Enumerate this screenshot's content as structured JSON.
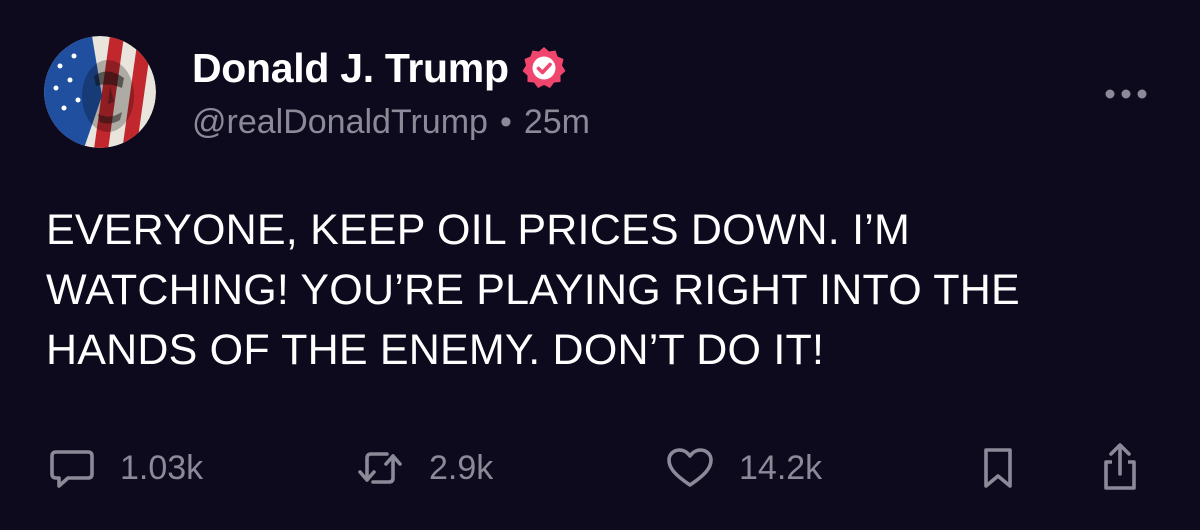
{
  "post": {
    "author": {
      "display_name": "Donald J. Trump",
      "handle": "@realDonaldTrump",
      "verified": true,
      "avatar_icon": "avatar-flag-portrait"
    },
    "separator": "•",
    "timestamp": "25m",
    "text": "EVERYONE, KEEP OIL PRICES DOWN. I’M WATCHING! YOU’RE PLAYING RIGHT INTO THE HANDS OF THE ENEMY. DON’T DO IT!",
    "actions": {
      "reply": {
        "icon": "comment-icon",
        "count": "1.03k"
      },
      "repost": {
        "icon": "repost-icon",
        "count": "2.9k"
      },
      "like": {
        "icon": "heart-icon",
        "count": "14.2k"
      },
      "bookmark": {
        "icon": "bookmark-icon"
      },
      "share": {
        "icon": "share-icon"
      }
    },
    "more_icon": "more-dots-icon"
  },
  "colors": {
    "background": "#0c0a1c",
    "primary_text": "#ffffff",
    "secondary_text": "#8b8a99",
    "verified_badge": "#f0466e"
  }
}
